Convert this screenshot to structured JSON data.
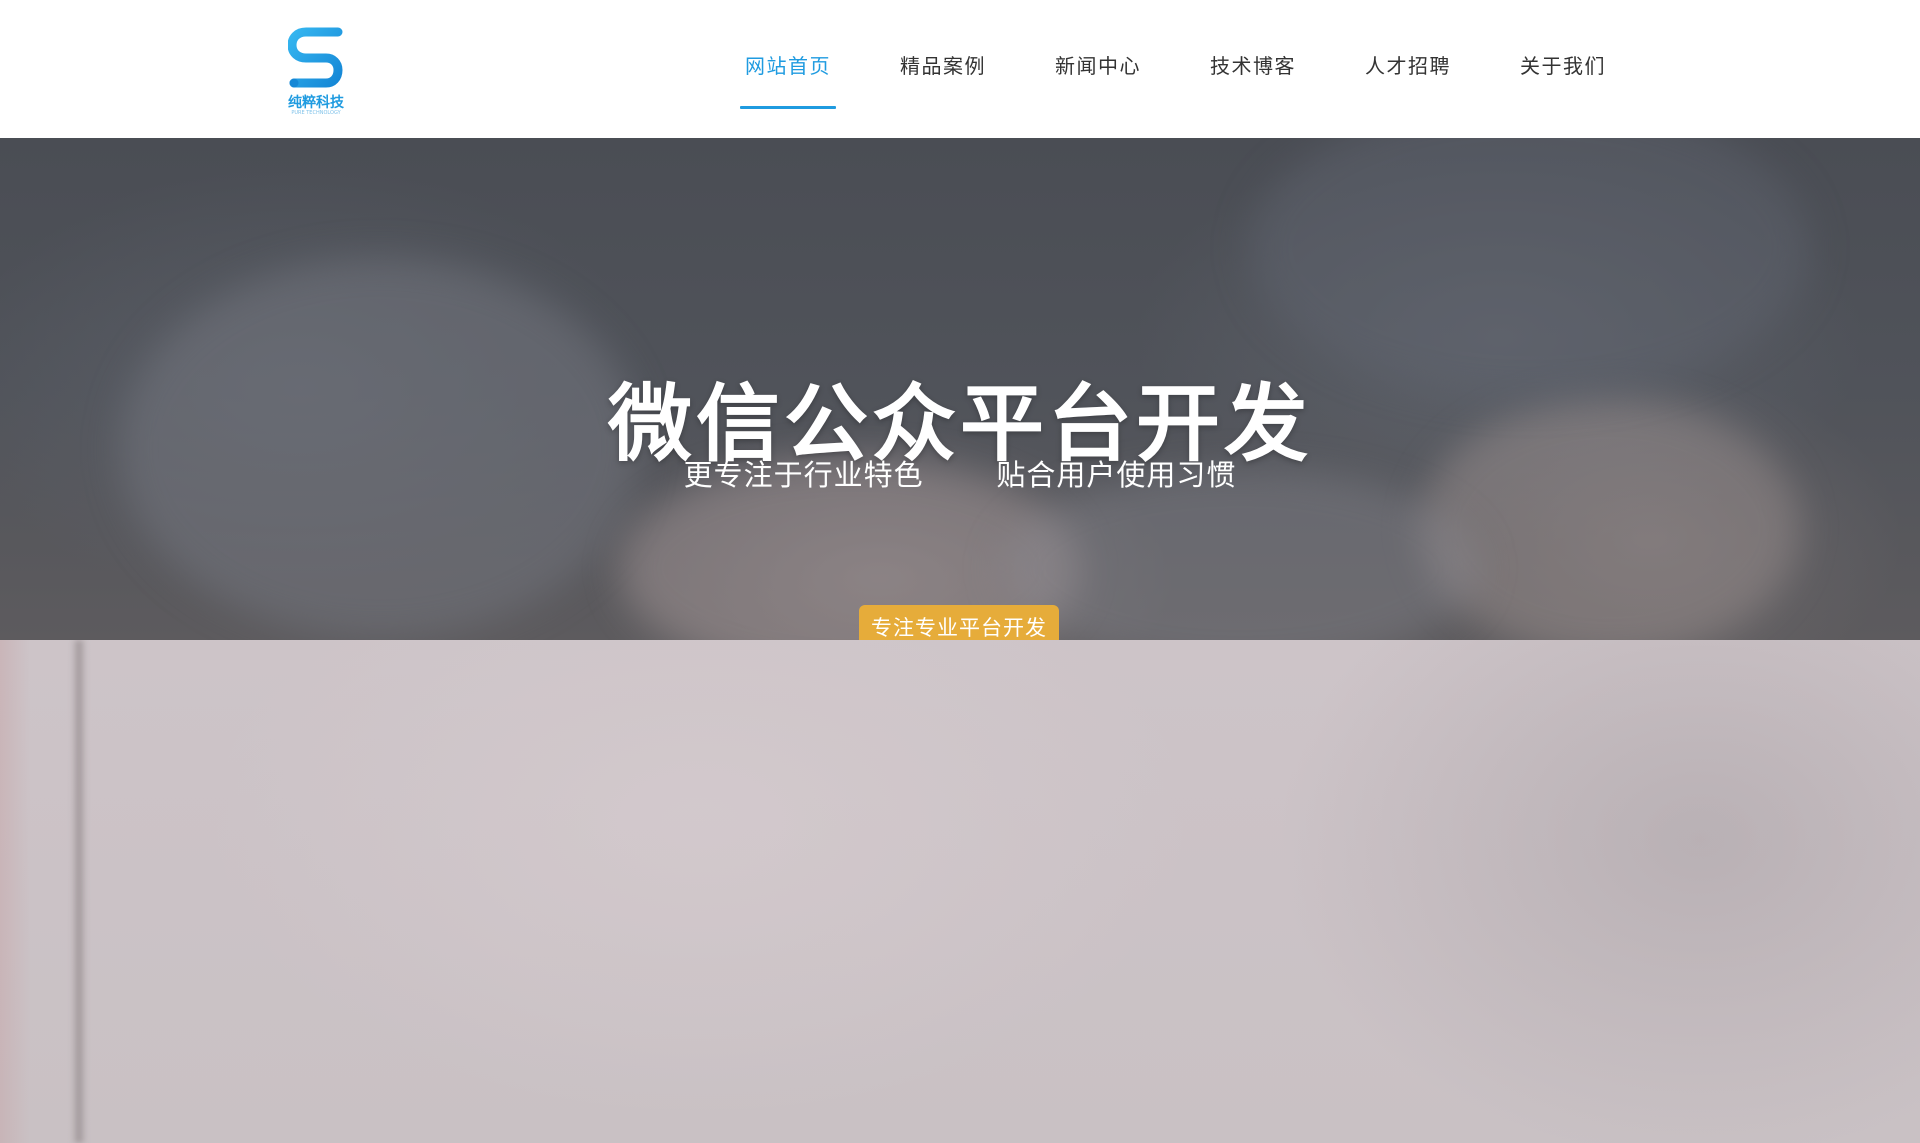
{
  "brand": {
    "name": "纯粹科技",
    "tagline": "PURE TECHNOLOGY",
    "accent_color": "#1f9be0"
  },
  "nav": {
    "items": [
      {
        "label": "网站首页",
        "active": true
      },
      {
        "label": "精品案例",
        "active": false
      },
      {
        "label": "新闻中心",
        "active": false
      },
      {
        "label": "技术博客",
        "active": false
      },
      {
        "label": "人才招聘",
        "active": false
      },
      {
        "label": "关于我们",
        "active": false
      }
    ]
  },
  "hero": {
    "title": "微信公众平台开发",
    "subtitle": "更专注于行业特色   贴合用户使用习惯",
    "button_label": "专注专业平台开发",
    "button_color": "#e6ac3a"
  }
}
